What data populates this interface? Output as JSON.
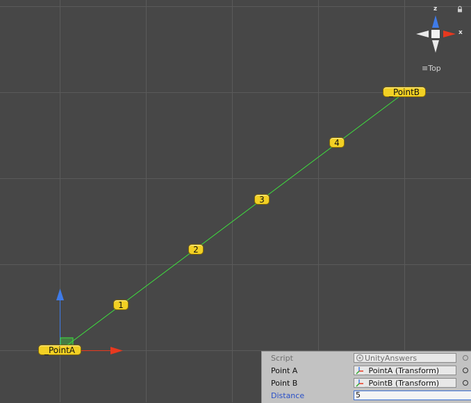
{
  "scene": {
    "point_a_label": "_PointA",
    "point_b_label": "_PointB",
    "segment_labels": [
      "1",
      "2",
      "3",
      "4"
    ],
    "line_color": "#3ee03e",
    "label_color": "#f2d024",
    "grid_color": "#5a5a5a"
  },
  "gizmo": {
    "z_label": "z",
    "x_label": "x",
    "view_label": "Top",
    "menu_icon": "hamburger-icon",
    "lock_icon": "lock-icon",
    "z_color": "#3f7be8",
    "x_color": "#e8391f"
  },
  "transform_handles": {
    "forward_color": "#3f7be8",
    "right_color": "#e8391f"
  },
  "inspector": {
    "script_label": "Script",
    "script_value": "UnityAnswers",
    "point_a_label": "Point A",
    "point_a_value": "_PointA (Transform)",
    "point_b_label": "Point B",
    "point_b_value": "_PointB (Transform)",
    "distance_label": "Distance",
    "distance_value": "5"
  }
}
